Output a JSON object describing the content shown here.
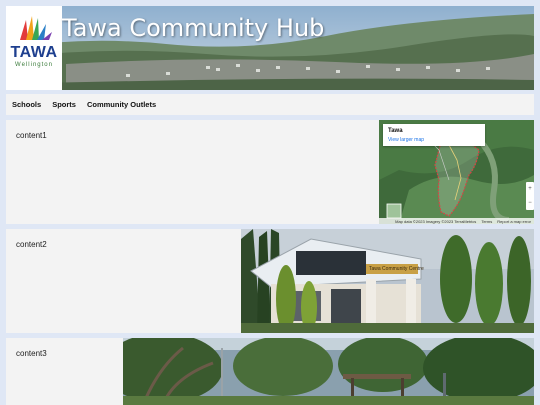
{
  "header": {
    "title": "Tawa Community Hub",
    "logo": {
      "text": "TAWA",
      "subtext": "Wellington"
    }
  },
  "nav": {
    "items": [
      {
        "label": "Schools"
      },
      {
        "label": "Sports"
      },
      {
        "label": "Community Outlets"
      }
    ]
  },
  "panels": [
    {
      "label": "content1",
      "map": {
        "place": "Tawa",
        "link": "View larger map",
        "footer": [
          "Map data ©2023 Imagery ©2023 TerraMetrics",
          "Terms",
          "Report a map error"
        ],
        "zoom_in": "+",
        "zoom_out": "−"
      }
    },
    {
      "label": "content2",
      "sign": "Tawa Community Centre"
    },
    {
      "label": "content3"
    }
  ]
}
